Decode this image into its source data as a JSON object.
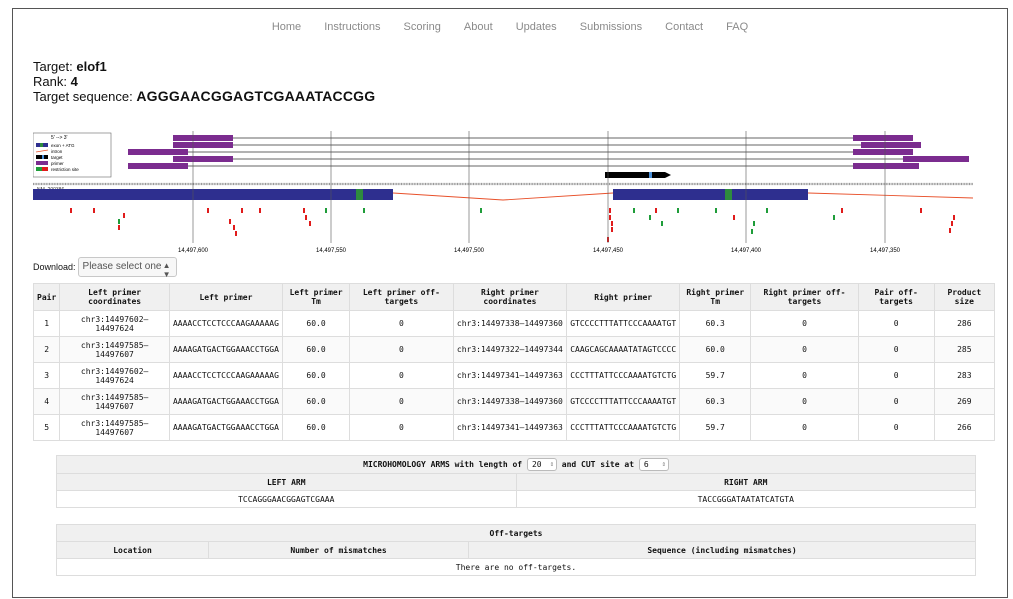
{
  "nav": [
    "Home",
    "Instructions",
    "Scoring",
    "About",
    "Updates",
    "Submissions",
    "Contact",
    "FAQ"
  ],
  "target": {
    "target_label": "Target:",
    "target_value": "elof1",
    "rank_label": "Rank:",
    "rank_value": "4",
    "seq_label": "Target sequence:",
    "seq_value": "AGGGAACGGAGTCGAAATACCGG"
  },
  "legend": {
    "direction": "5' --> 3'",
    "items": [
      "exon + ATG",
      "intron",
      "target",
      "primer",
      "restriction site"
    ]
  },
  "colors": {
    "primer": "#7b2c8f",
    "exon": "#2e2f8f",
    "atg": "#2e8b3e",
    "intron": "#e8502a",
    "target": "#000000",
    "restriction_red": "#e01b1b",
    "restriction_green": "#1f9d3a"
  },
  "transcript_label": "NM_200386",
  "axis_ticks": [
    "14,497,600",
    "14,497,550",
    "14,497,500",
    "14,497,450",
    "14,497,400",
    "14,497,350"
  ],
  "download": {
    "label": "Download:",
    "placeholder": "Please select one"
  },
  "primer_table": {
    "headers": [
      "Pair",
      "Left primer coordinates",
      "Left primer",
      "Left primer Tm",
      "Left primer off-targets",
      "Right primer coordinates",
      "Right primer",
      "Right primer Tm",
      "Right primer off-targets",
      "Pair off-targets",
      "Product size"
    ],
    "rows": [
      [
        "1",
        "chr3:14497602–14497624",
        "AAAACCTCCTCCCAAGAAAAAG",
        "60.0",
        "0",
        "chr3:14497338–14497360",
        "GTCCCCTTTATTCCCAAAATGT",
        "60.3",
        "0",
        "0",
        "286"
      ],
      [
        "2",
        "chr3:14497585–14497607",
        "AAAAGATGACTGGAAACCTGGA",
        "60.0",
        "0",
        "chr3:14497322–14497344",
        "CAAGCAGCAAAATATAGTCCCC",
        "60.0",
        "0",
        "0",
        "285"
      ],
      [
        "3",
        "chr3:14497602–14497624",
        "AAAACCTCCTCCCAAGAAAAAG",
        "60.0",
        "0",
        "chr3:14497341–14497363",
        "CCCTTTATTCCCAAAATGTCTG",
        "59.7",
        "0",
        "0",
        "283"
      ],
      [
        "4",
        "chr3:14497585–14497607",
        "AAAAGATGACTGGAAACCTGGA",
        "60.0",
        "0",
        "chr3:14497338–14497360",
        "GTCCCCTTTATTCCCAAAATGT",
        "60.3",
        "0",
        "0",
        "269"
      ],
      [
        "5",
        "chr3:14497585–14497607",
        "AAAAGATGACTGGAAACCTGGA",
        "60.0",
        "0",
        "chr3:14497341–14497363",
        "CCCTTTATTCCCAAAATGTCTG",
        "59.7",
        "0",
        "0",
        "266"
      ]
    ]
  },
  "microhomology": {
    "title_prefix": "MICROHOMOLOGY ARMS with length of",
    "length_value": "20",
    "title_mid": "and CUT site at",
    "cut_value": "6",
    "left_header": "LEFT ARM",
    "right_header": "RIGHT ARM",
    "left_arm": "TCCAGGGAACGGAGTCGAAA",
    "right_arm": "TACCGGGATAATATCATGTA"
  },
  "offtargets": {
    "title": "Off-targets",
    "headers": [
      "Location",
      "Number of mismatches",
      "Sequence (including mismatches)"
    ],
    "empty_text": "There are no off-targets."
  }
}
